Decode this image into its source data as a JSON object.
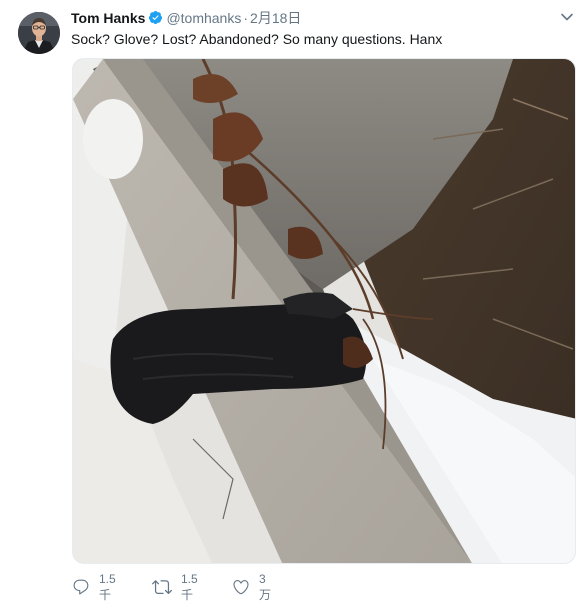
{
  "tweet": {
    "author_name": "Tom Hanks",
    "author_handle": "@tomhanks",
    "separator": "·",
    "date": "2月18日",
    "text": "Sock? Glove? Lost? Abandoned? So many questions. Hanx",
    "media_alt": "black sock lying on snowy curb beside dirt and dry plant"
  },
  "actions": {
    "reply": {
      "icon": "reply-icon",
      "count": "1.5千"
    },
    "retweet": {
      "icon": "retweet-icon",
      "count": "1.5千"
    },
    "like": {
      "icon": "heart-icon",
      "count": "3万"
    }
  },
  "icons": {
    "verified": "verified-badge-icon",
    "menu": "chevron-down-icon"
  },
  "colors": {
    "accent": "#1da1f2",
    "secondary_text": "#657786",
    "primary_text": "#14171a"
  }
}
